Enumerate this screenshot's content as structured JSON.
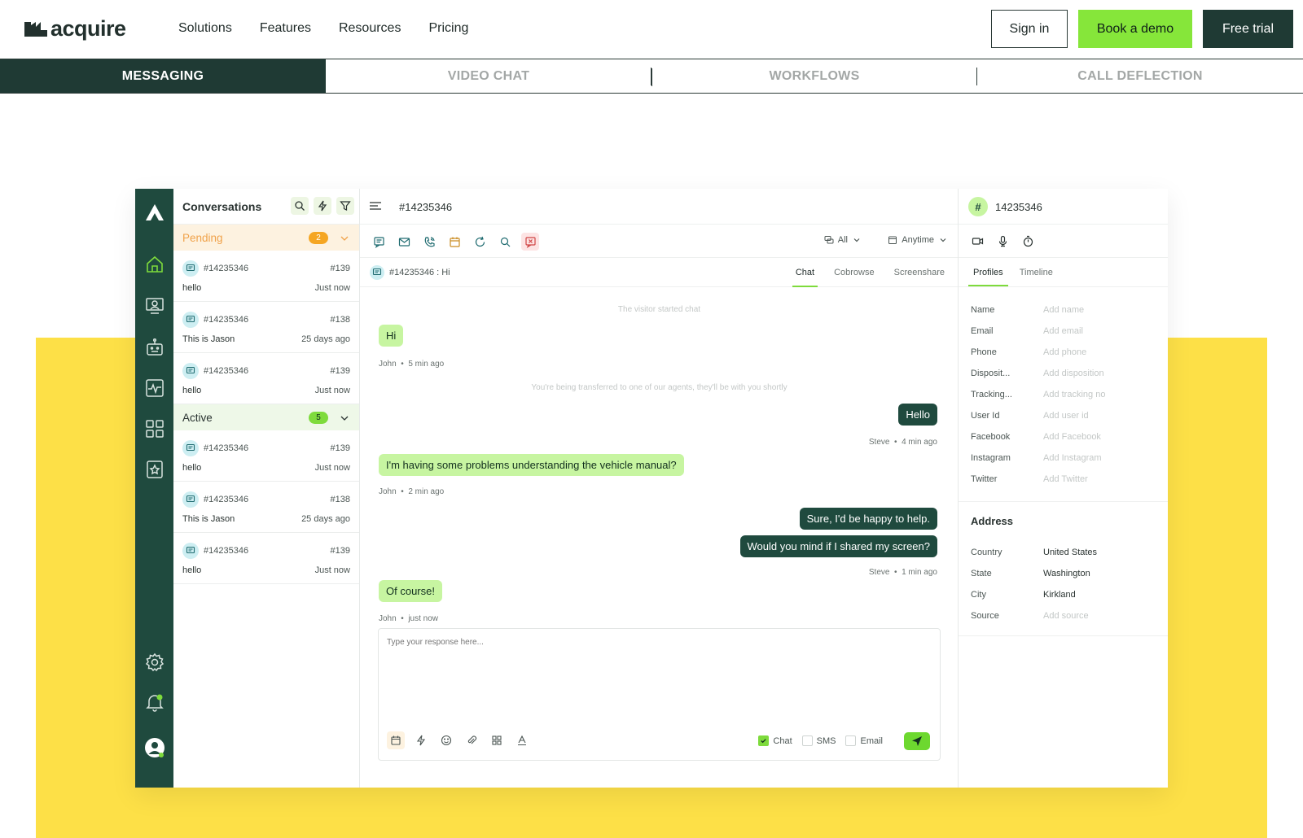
{
  "brand": {
    "name": "acquire",
    "colors": {
      "dark": "#1f3a34",
      "green": "#86e63a",
      "yellow": "#fde047"
    }
  },
  "nav": {
    "links": [
      "Solutions",
      "Features",
      "Resources",
      "Pricing"
    ],
    "sign_in": "Sign in",
    "book_demo": "Book a demo",
    "free_trial": "Free trial"
  },
  "product_tabs": [
    "MESSAGING",
    "VIDEO CHAT",
    "WORKFLOWS",
    "CALL DEFLECTION"
  ],
  "app": {
    "conversations": {
      "title": "Conversations",
      "pending": {
        "label": "Pending",
        "count": "2"
      },
      "active": {
        "label": "Active",
        "count": "5"
      },
      "pending_items": [
        {
          "id": "#14235346",
          "num": "#139",
          "msg": "hello",
          "time": "Just now"
        },
        {
          "id": "#14235346",
          "num": "#138",
          "msg": "This is Jason",
          "time": "25 days ago"
        },
        {
          "id": "#14235346",
          "num": "#139",
          "msg": "hello",
          "time": "Just now"
        }
      ],
      "active_items": [
        {
          "id": "#14235346",
          "num": "#139",
          "msg": "hello",
          "time": "Just now"
        },
        {
          "id": "#14235346",
          "num": "#138",
          "msg": "This is Jason",
          "time": "25 days ago"
        },
        {
          "id": "#14235346",
          "num": "#139",
          "msg": "hello",
          "time": "Just now"
        }
      ]
    },
    "chat": {
      "title": "#14235346",
      "filter_all": "All",
      "filter_time": "Anytime",
      "subhead": "#14235346  : Hi",
      "tabs": [
        "Chat",
        "Cobrowse",
        "Screenshare"
      ],
      "system_start": "The visitor started chat",
      "system_transfer": "You're being transferred to one of our agents, they'll be with you shortly",
      "messages": [
        {
          "text": "Hi",
          "author": "John",
          "time": "5 min ago"
        },
        {
          "text": "Hello",
          "author": "Steve",
          "time": "4 min ago"
        },
        {
          "text": "I'm having some problems understanding the vehicle manual?",
          "author": "John",
          "time": "2 min ago"
        },
        {
          "text": "Sure, I'd be happy to help.",
          "author": "",
          "time": ""
        },
        {
          "text": "Would you mind if I shared my screen?",
          "author": "Steve",
          "time": "1 min ago"
        },
        {
          "text": "Of course!",
          "author": "John",
          "time": "just now"
        }
      ],
      "composer_placeholder": "Type your response here...",
      "channels": [
        "Chat",
        "SMS",
        "Email"
      ]
    },
    "profile": {
      "title": "14235346",
      "badge": "#",
      "tabs": [
        "Profiles",
        "Timeline"
      ],
      "fields": [
        {
          "label": "Name",
          "value": "Add name"
        },
        {
          "label": "Email",
          "value": "Add email"
        },
        {
          "label": "Phone",
          "value": "Add phone"
        },
        {
          "label": "Disposit...",
          "value": "Add disposition"
        },
        {
          "label": "Tracking...",
          "value": "Add tracking no"
        },
        {
          "label": "User Id",
          "value": "Add user id"
        },
        {
          "label": "Facebook",
          "value": "Add Facebook"
        },
        {
          "label": "Instagram",
          "value": "Add Instagram"
        },
        {
          "label": "Twitter",
          "value": "Add Twitter"
        }
      ],
      "address_title": "Address",
      "address": [
        {
          "label": "Country",
          "value": "United States"
        },
        {
          "label": "State",
          "value": "Washington"
        },
        {
          "label": "City",
          "value": "Kirkland"
        },
        {
          "label": "Source",
          "value": "Add source"
        }
      ]
    }
  }
}
